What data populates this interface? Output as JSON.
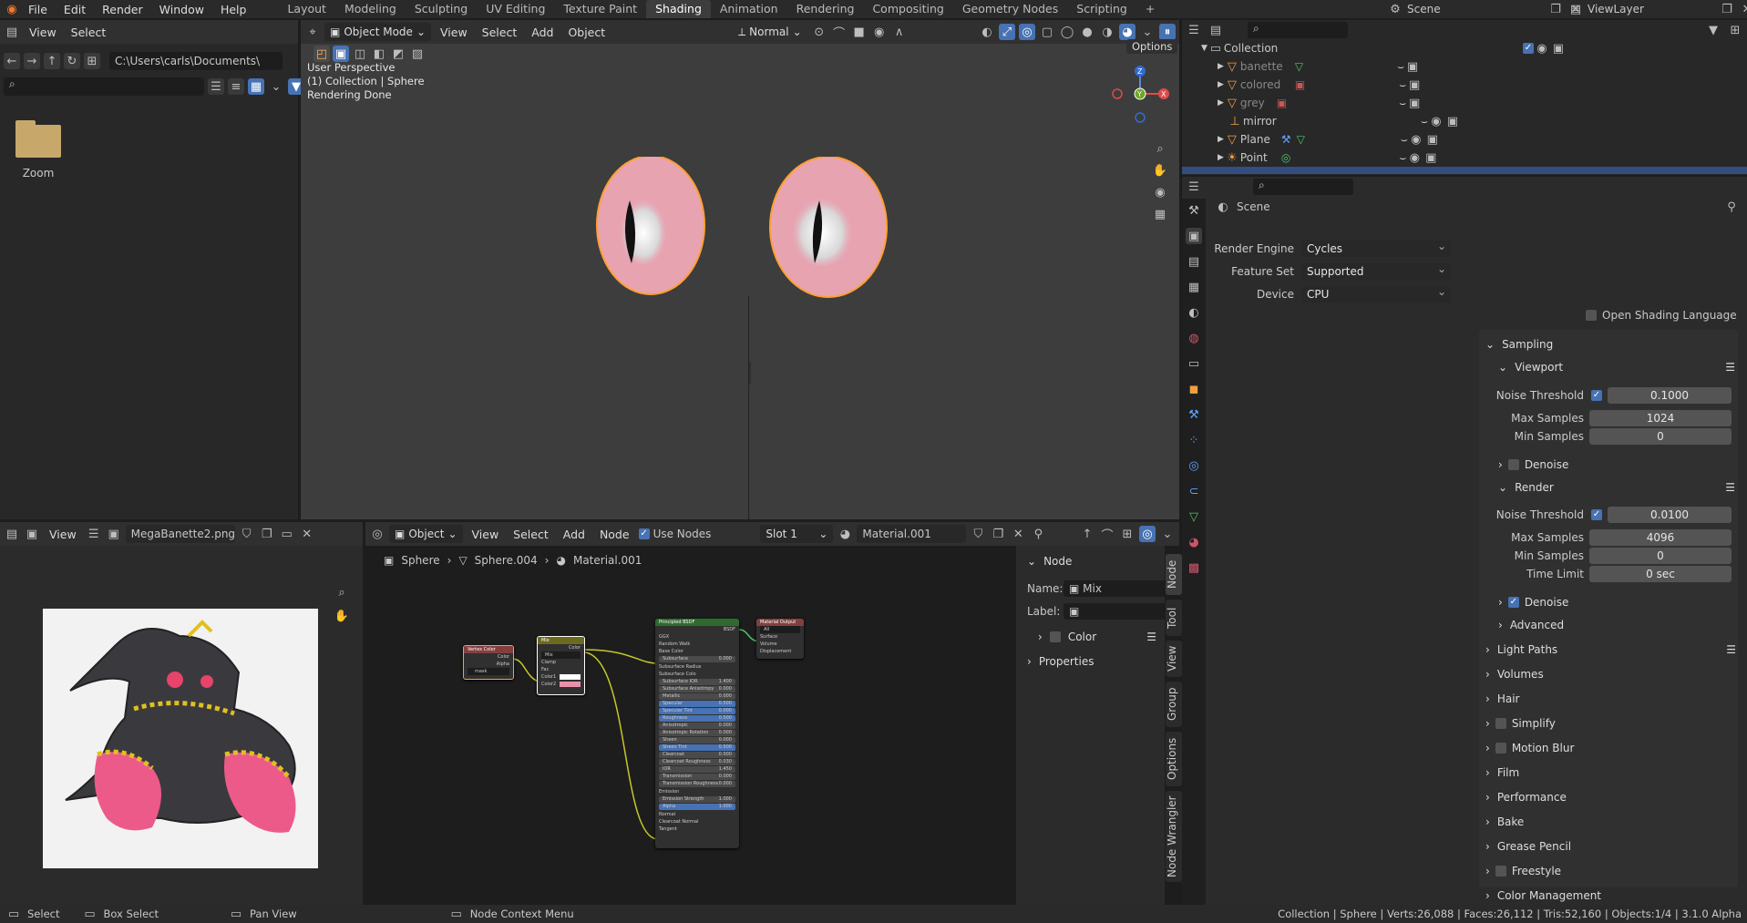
{
  "topbar": {
    "menus": [
      "File",
      "Edit",
      "Render",
      "Window",
      "Help"
    ],
    "workspaces": [
      "Layout",
      "Modeling",
      "Sculpting",
      "UV Editing",
      "Texture Paint",
      "Shading",
      "Animation",
      "Rendering",
      "Compositing",
      "Geometry Nodes",
      "Scripting"
    ],
    "active_workspace": "Shading",
    "plus": "+",
    "scene": "Scene",
    "view_layer": "ViewLayer"
  },
  "filebrowser": {
    "view": "View",
    "select": "Select",
    "path": "C:\\Users\\carls\\Documents\\",
    "items": [
      {
        "name": "Zoom",
        "icon": "folder-icon"
      }
    ]
  },
  "viewport": {
    "mode": "Object Mode",
    "menus": [
      "View",
      "Select",
      "Add",
      "Object"
    ],
    "orientation": "Normal",
    "options": "Options",
    "overlay": [
      "User Perspective",
      "(1) Collection | Sphere",
      "Rendering Done"
    ],
    "gizmo": {
      "z": "Z",
      "y": "Y",
      "x": "X"
    }
  },
  "outliner": {
    "collection": "Collection",
    "items": [
      "banette",
      "colored",
      "grey",
      "mirror",
      "Plane",
      "Point"
    ]
  },
  "properties": {
    "scene": "Scene",
    "render_engine_label": "Render Engine",
    "render_engine": "Cycles",
    "feature_set_label": "Feature Set",
    "feature_set": "Supported",
    "device_label": "Device",
    "device": "CPU",
    "osl": "Open Shading Language",
    "sampling": "Sampling",
    "viewport": "Viewport",
    "vp_noise_label": "Noise Threshold",
    "vp_noise": "0.1000",
    "vp_max_label": "Max Samples",
    "vp_max": "1024",
    "vp_min_label": "Min Samples",
    "vp_min": "0",
    "denoise": "Denoise",
    "render": "Render",
    "r_noise_label": "Noise Threshold",
    "r_noise": "0.0100",
    "r_max_label": "Max Samples",
    "r_max": "4096",
    "r_min_label": "Min Samples",
    "r_min": "0",
    "r_time_label": "Time Limit",
    "r_time": "0 sec",
    "r_denoise": "Denoise",
    "advanced": "Advanced",
    "panels": [
      "Light Paths",
      "Volumes",
      "Hair",
      "Simplify",
      "Motion Blur",
      "Film",
      "Performance",
      "Bake",
      "Grease Pencil",
      "Freestyle",
      "Color Management"
    ]
  },
  "image_editor": {
    "view": "View",
    "image": "MegaBanette2.png"
  },
  "node_editor": {
    "type": "Object",
    "menus": [
      "View",
      "Select",
      "Add",
      "Node"
    ],
    "use_nodes": "Use Nodes",
    "slot": "Slot 1",
    "material": "Material.001",
    "breadcrumb": [
      "Sphere",
      "Sphere.004",
      "Material.001"
    ],
    "sidebar": {
      "section": "Node",
      "name_label": "Name:",
      "name": "Mix",
      "label_label": "Label:",
      "color": "Color",
      "properties": "Properties"
    },
    "tabs": [
      "Node",
      "Tool",
      "View",
      "Group",
      "Options",
      "Node Wrangler"
    ],
    "nodes": {
      "vc": {
        "title": "Vertex Color",
        "rows": [
          "Color",
          "Alpha",
          "mask"
        ]
      },
      "mix": {
        "title": "Mix",
        "rows": [
          "Color",
          "Mix",
          "Clamp",
          "Fac",
          "Color1",
          "Color2"
        ]
      },
      "bsdf": {
        "title": "Principled BSDF",
        "rows": [
          "BSDF",
          "GGX",
          "Random Walk",
          "Base Color",
          "Subsurface",
          "Subsurface Radius",
          "Subsurface Colo",
          "Subsurface IOR",
          "Subsurface Anisotropy",
          "Metallic",
          "Specular",
          "Specular Tint",
          "Roughness",
          "Anisotropic",
          "Anisotropic Rotation",
          "Sheen",
          "Sheen Tint",
          "Clearcoat",
          "Clearcoat Roughness",
          "IOR",
          "Transmission",
          "Transmission Roughness",
          "Emission",
          "Emission Strength",
          "Alpha",
          "Normal",
          "Clearcoat Normal",
          "Tangent"
        ],
        "vals": [
          "",
          "",
          "",
          "",
          "0.000",
          "",
          "",
          "1.400",
          "0.000",
          "0.000",
          "0.500",
          "0.000",
          "0.500",
          "0.000",
          "0.000",
          "0.000",
          "0.500",
          "0.000",
          "0.030",
          "1.450",
          "0.000",
          "0.000",
          "",
          "1.000",
          "1.000",
          "",
          "",
          ""
        ]
      },
      "out": {
        "title": "Material Output",
        "rows": [
          "All",
          "Surface",
          "Volume",
          "Displacement"
        ]
      }
    }
  },
  "statusbar": {
    "items": [
      "Select",
      "Box Select",
      "Pan View",
      "Node Context Menu"
    ],
    "info": "Collection | Sphere | Verts:26,088 | Faces:26,112 | Tris:52,160 | Objects:1/4 | 3.1.0 Alpha"
  },
  "colors": {
    "accent": "#4772b3",
    "active": "#ffa033",
    "pink": "#e891a8"
  }
}
